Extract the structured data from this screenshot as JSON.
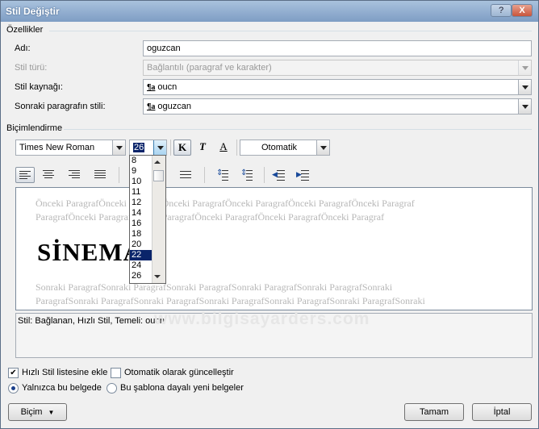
{
  "window": {
    "title": "Stil Değiştir",
    "help_label": "?",
    "close_label": "X"
  },
  "properties": {
    "section_label": "Özellikler",
    "name_label": "Adı:",
    "name_value": "oguzcan",
    "type_label": "Stil türü:",
    "type_value": "Bağlantılı (paragraf ve karakter)",
    "based_on_label": "Stil kaynağı:",
    "based_on_value": "oucn",
    "next_label": "Sonraki paragrafın stili:",
    "next_value": "oguzcan",
    "style_icon": "¶a"
  },
  "formatting": {
    "section_label": "Biçimlendirme",
    "font_value": "Times New Roman",
    "size_value": "26",
    "bold_label": "K",
    "italic_label": "T",
    "underline_label": "A",
    "color_value": "Otomatik"
  },
  "size_dropdown": {
    "items": [
      "8",
      "9",
      "10",
      "11",
      "12",
      "14",
      "16",
      "18",
      "20",
      "22",
      "24",
      "26"
    ],
    "selected": "22"
  },
  "preview": {
    "before_line1": "Önceki ParagrafÖnceki ParagrafÖnceki ParagrafÖnceki ParagrafÖnceki ParagrafÖnceki Paragraf",
    "before_line2": "ParagrafÖnceki ParagrafÖnceki ParagrafÖnceki ParagrafÖnceki ParagrafÖnceki Paragraf",
    "sample": "SİNEMA",
    "after_line1": "Sonraki ParagrafSonraki ParagrafSonraki ParagrafSonraki ParagrafSonraki ParagrafSonraki",
    "after_line2": "ParagrafSonraki ParagrafSonraki ParagrafSonraki ParagrafSonraki ParagrafSonraki ParagrafSonraki"
  },
  "description": "Stil: Bağlanan, Hızlı Stil, Temeli: oucn",
  "watermark": "www.bilgisayarders.com",
  "options": {
    "quick_style_label": "Hızlı Stil listesine ekle",
    "quick_style_checked": true,
    "auto_update_label": "Otomatik olarak güncelleştir",
    "auto_update_checked": false,
    "this_doc_label": "Yalnızca bu belgede",
    "template_label": "Bu şablona dayalı yeni belgeler"
  },
  "buttons": {
    "format": "Biçim",
    "ok": "Tamam",
    "cancel": "İptal"
  },
  "colors": {
    "selection": "#0a246a",
    "title_bar": "#8fabd0"
  }
}
